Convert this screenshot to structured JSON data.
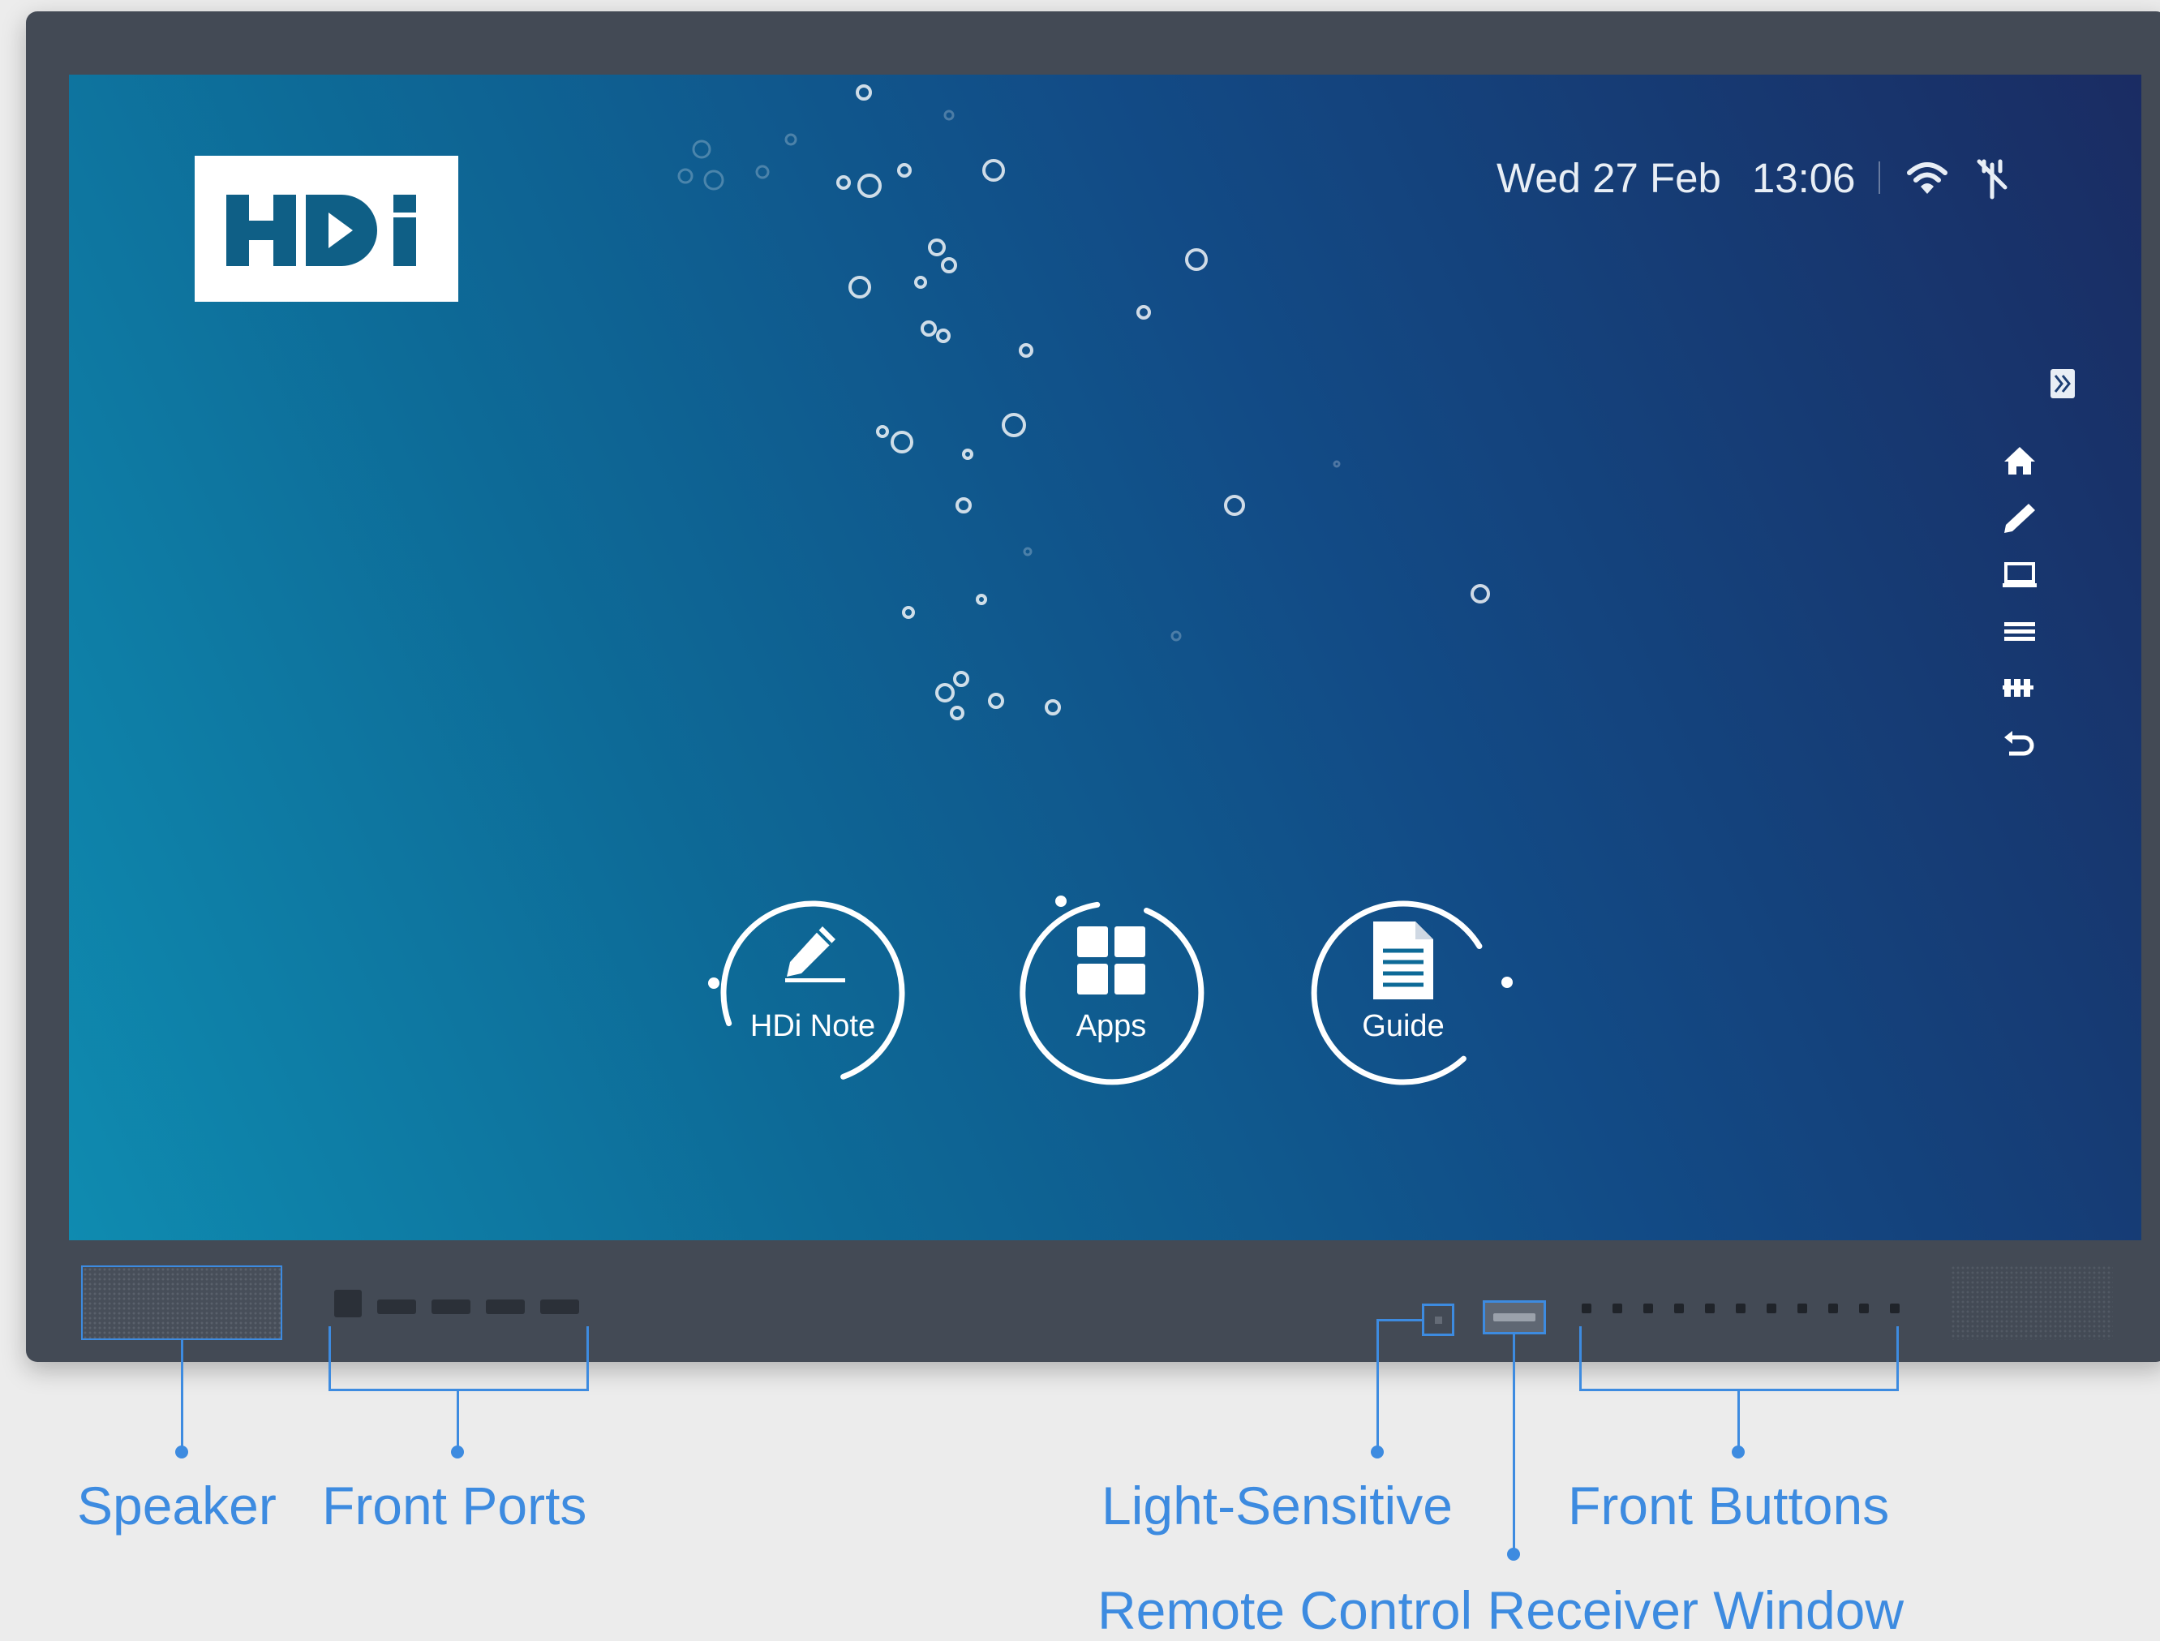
{
  "logo": {
    "text": "HDi"
  },
  "status_bar": {
    "date": "Wed 27 Feb",
    "time": "13:06",
    "icons": [
      "wifi-icon",
      "network-icon"
    ]
  },
  "sidebar": {
    "items": [
      "home-icon",
      "pen-icon",
      "screen-icon",
      "menu-icon",
      "grid-icon",
      "back-icon"
    ],
    "collapse": "collapse-icon"
  },
  "launchers": [
    {
      "label": "HDi Note",
      "icon": "pencil-icon"
    },
    {
      "label": "Apps",
      "icon": "apps-grid-icon"
    },
    {
      "label": "Guide",
      "icon": "document-icon"
    }
  ],
  "callouts": {
    "speaker": "Speaker",
    "front_ports": "Front Ports",
    "light_sensitive": "Light-Sensitive",
    "front_buttons": "Front Buttons",
    "remote_window": "Remote Control Receiver Window"
  },
  "colors": {
    "accent": "#3d8be0",
    "bezel": "#434a55",
    "screen_start": "#0f8bb0",
    "screen_end": "#1a2c63",
    "logo_blue": "#0f5f86"
  }
}
